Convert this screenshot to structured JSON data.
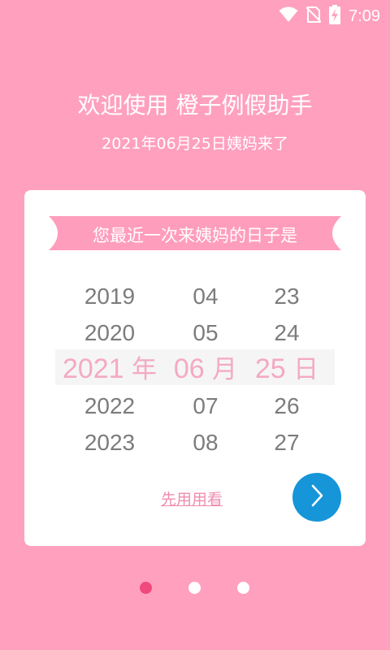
{
  "status_bar": {
    "time": "7:09",
    "icons": [
      "wifi-icon",
      "no-sim-icon",
      "battery-charging-icon"
    ]
  },
  "header": {
    "title": "欢迎使用 橙子例假助手",
    "subtitle": "2021年06月25日姨妈来了"
  },
  "card": {
    "ribbon_text": "您最近一次来姨妈的日子是",
    "picker": {
      "years": [
        "2019",
        "2020",
        "2021",
        "2022",
        "2023"
      ],
      "months": [
        "04",
        "05",
        "06",
        "07",
        "08"
      ],
      "days": [
        "23",
        "24",
        "25",
        "26",
        "27"
      ],
      "selected": {
        "year": "2021",
        "month": "06",
        "day": "25"
      },
      "units": {
        "year": "年",
        "month": "月",
        "day": "日"
      }
    },
    "try_link": "先用用看",
    "next_icon": "chevron-right-icon"
  },
  "pager": {
    "count": 3,
    "active_index": 0
  },
  "colors": {
    "background": "#ffa0bf",
    "card": "#ffffff",
    "ribbon": "#ff9dbd",
    "selected_text": "#f4a9c4",
    "next_button": "#1695d8",
    "active_dot": "#f0497d"
  }
}
